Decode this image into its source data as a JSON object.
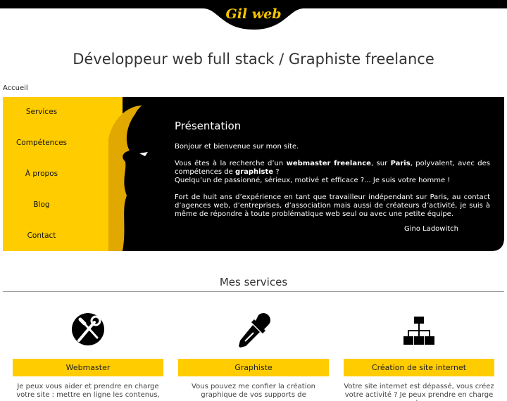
{
  "site": {
    "logo_text": "Gil web",
    "headline": "Développeur web full stack / Graphiste freelance",
    "breadcrumb": "Accueil"
  },
  "menu": [
    "Services",
    "Compétences",
    "À propos",
    "Blog",
    "Contact"
  ],
  "presentation": {
    "title": "Présentation",
    "greeting": "Bonjour et bienvenue sur mon site.",
    "p2_a": "Vous êtes à la recherche d’un ",
    "p2_b": "webmaster freelance",
    "p2_c": ", sur ",
    "p2_d": "Paris",
    "p2_e": ", polyvalent, avec des compétences de ",
    "p2_f": "graphiste",
    "p2_g": " ?",
    "p2_line2": "Quelqu’un de passionné, sérieux, motivé et efficace ?... Je suis votre homme !",
    "p3": "Fort de huit ans d’expérience en tant que travailleur indépendant sur Paris, au contact d’agences web, d’entreprises, d’association mais aussi de créateurs d’activité, je suis à même de répondre à toute problématique web seul ou avec une petite équipe.",
    "signature": "Gino Ladowitch"
  },
  "services": {
    "title": "Mes services",
    "items": [
      {
        "icon": "tools-icon",
        "label": "Webmaster",
        "desc": "Je peux vous aider et prendre en charge votre site : mettre en ligne les contenus,"
      },
      {
        "icon": "eyedropper-icon",
        "label": "Graphiste",
        "desc": "Vous pouvez me confier la création graphique de vos supports de"
      },
      {
        "icon": "sitemap-icon",
        "label": "Création de site internet",
        "desc": "Votre site internet est dépassé, vous créez votre activité ? Je peux prendre en charge la"
      }
    ]
  },
  "colors": {
    "accent": "#ffcc00",
    "dark": "#000000"
  }
}
